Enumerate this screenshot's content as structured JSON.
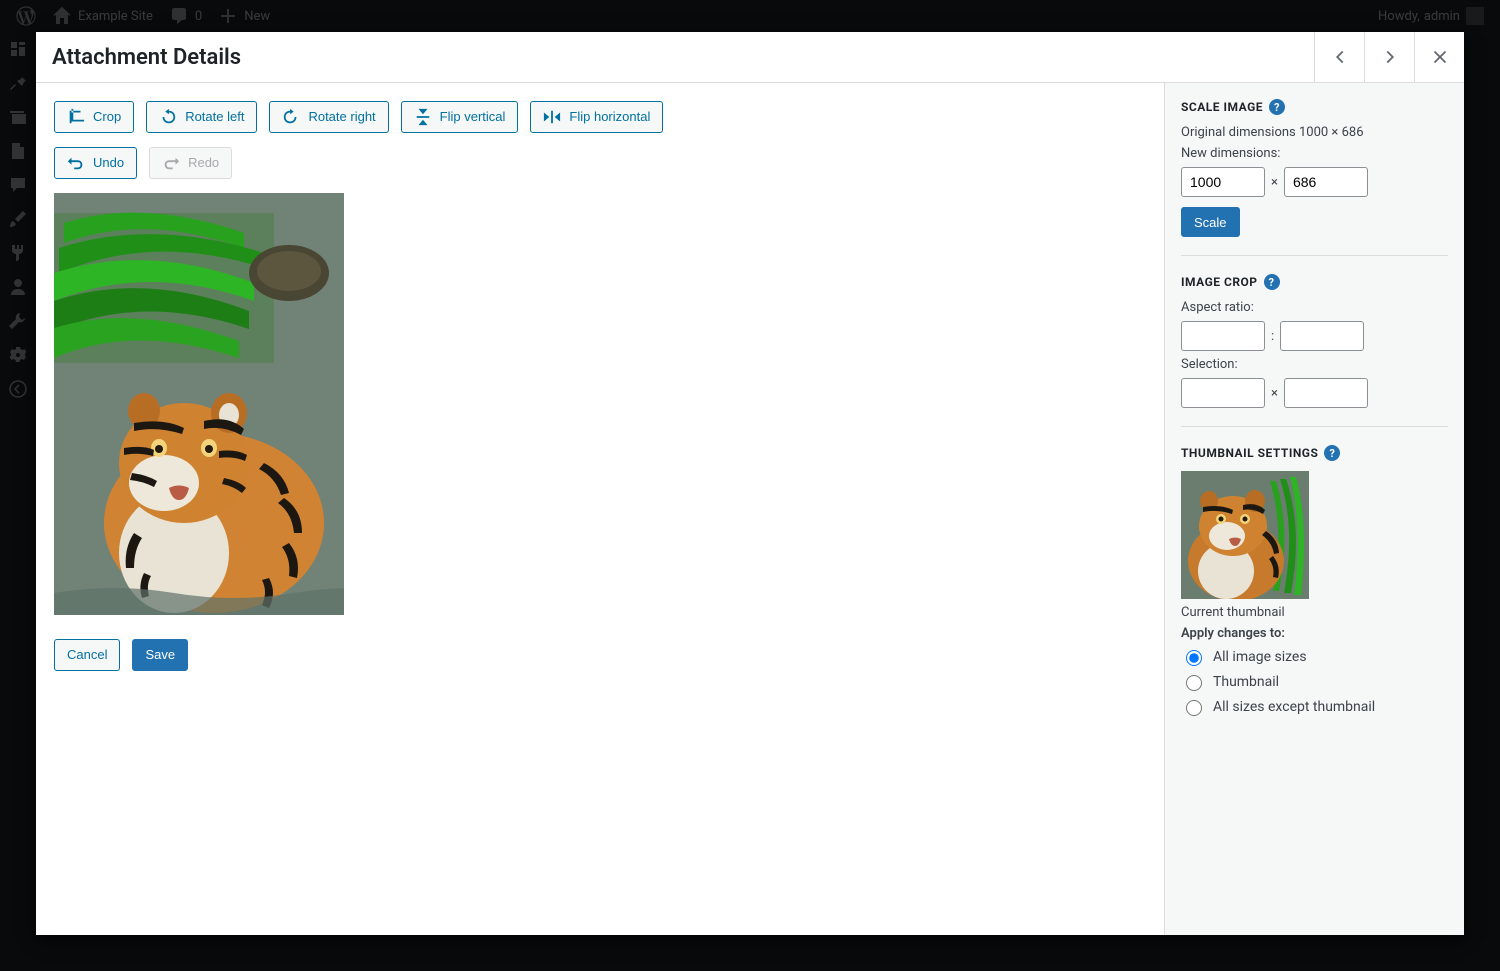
{
  "adminbar": {
    "site_name": "Example Site",
    "comments_count": "0",
    "new_label": "New",
    "howdy": "Howdy,",
    "user": "admin"
  },
  "modal": {
    "title": "Attachment Details"
  },
  "toolbar": {
    "crop": "Crop",
    "rotate_left": "Rotate left",
    "rotate_right": "Rotate right",
    "flip_vertical": "Flip vertical",
    "flip_horizontal": "Flip horizontal",
    "undo": "Undo",
    "redo": "Redo",
    "cancel": "Cancel",
    "save": "Save"
  },
  "scale": {
    "heading": "Scale Image",
    "original_label": "Original dimensions 1000 × 686",
    "new_label": "New dimensions:",
    "width": "1000",
    "height": "686",
    "times": "×",
    "button": "Scale"
  },
  "crop": {
    "heading": "Image Crop",
    "aspect_label": "Aspect ratio:",
    "aspect_sep": ":",
    "selection_label": "Selection:",
    "selection_sep": "×"
  },
  "thumb": {
    "heading": "Thumbnail Settings",
    "current_label": "Current thumbnail",
    "apply_label": "Apply changes to:",
    "opt_all": "All image sizes",
    "opt_thumb": "Thumbnail",
    "opt_except": "All sizes except thumbnail"
  }
}
